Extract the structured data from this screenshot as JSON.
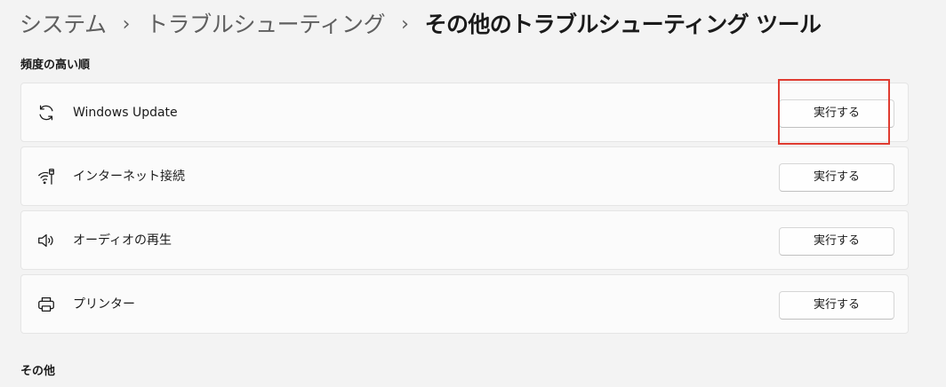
{
  "breadcrumb": {
    "items": [
      "システム",
      "トラブルシューティング"
    ],
    "current": "その他のトラブルシューティング ツール",
    "separator": "›"
  },
  "sections": {
    "frequent": {
      "heading": "頻度の高い順",
      "items": [
        {
          "label": "Windows Update",
          "icon": "refresh-icon",
          "button": "実行する"
        },
        {
          "label": "インターネット接続",
          "icon": "wifi-ethernet-icon",
          "button": "実行する"
        },
        {
          "label": "オーディオの再生",
          "icon": "speaker-icon",
          "button": "実行する"
        },
        {
          "label": "プリンター",
          "icon": "printer-icon",
          "button": "実行する"
        }
      ]
    },
    "other": {
      "heading": "その他"
    }
  },
  "annotation": {
    "highlight_color": "#e03c31",
    "highlighted_item": "Windows Update"
  },
  "colors": {
    "background": "#f3f3f3",
    "card": "#fbfbfb",
    "breadcrumb_inactive": "#5f5f5f"
  }
}
